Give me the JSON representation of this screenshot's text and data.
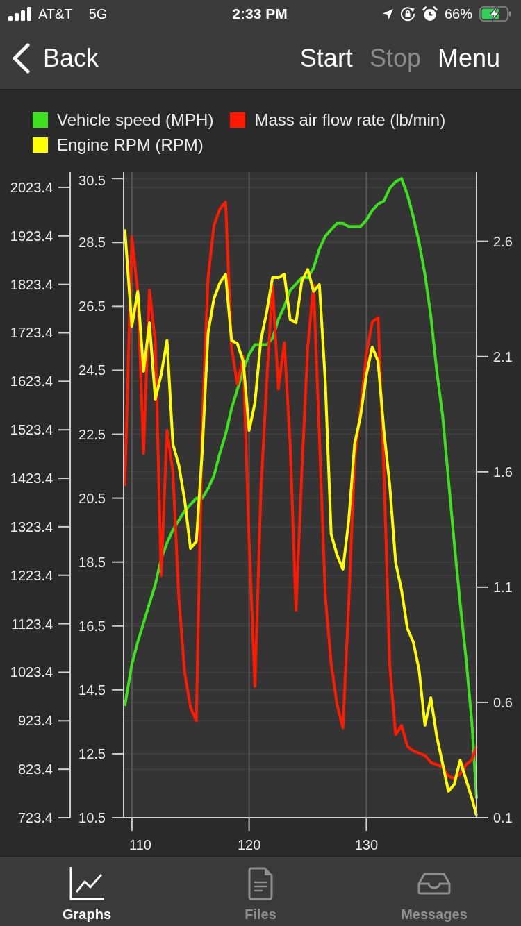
{
  "status_bar": {
    "carrier": "AT&T",
    "network": "5G",
    "time": "2:33 PM",
    "battery": "66%"
  },
  "nav_bar": {
    "back": "Back",
    "actions": [
      {
        "label": "Start",
        "disabled": false
      },
      {
        "label": "Stop",
        "disabled": true
      },
      {
        "label": "Menu",
        "disabled": false
      }
    ]
  },
  "graph": {
    "chart_data": {
      "type": "line",
      "legend": "top",
      "grid": true,
      "x": [
        109.4,
        110,
        110.5,
        111,
        111.5,
        112,
        112.5,
        113,
        113.5,
        114,
        114.5,
        115,
        115.5,
        116,
        116.5,
        117,
        117.5,
        118,
        118.5,
        119,
        119.5,
        120,
        120.5,
        121,
        121.5,
        122,
        122.5,
        123,
        123.5,
        124,
        124.5,
        125,
        125.5,
        126,
        126.5,
        127,
        127.5,
        128,
        128.5,
        129,
        129.5,
        130,
        130.5,
        131,
        131.5,
        132,
        132.5,
        133,
        133.5,
        134,
        134.5,
        135,
        135.5,
        136,
        136.5,
        137,
        137.5,
        138,
        138.5,
        139,
        139.4
      ],
      "xlim": [
        109.3,
        139.4
      ],
      "xticks": [
        110,
        120,
        130
      ],
      "ylim": [
        10.5,
        30.7
      ],
      "yticks": [
        10.5,
        12.5,
        14.5,
        16.5,
        18.5,
        20.5,
        22.5,
        24.5,
        26.5,
        28.5,
        30.5
      ],
      "y2lim": [
        0.1,
        2.9
      ],
      "y2ticks": [
        0.1,
        0.6,
        1.1,
        1.6,
        2.1,
        2.6
      ],
      "y3lim": [
        723.4,
        2054.8
      ],
      "y3ticks": [
        723.4,
        823.4,
        923.4,
        1023.4,
        1123.4,
        1223.4,
        1323.4,
        1423.4,
        1523.4,
        1623.4,
        1723.4,
        1823.4,
        1923.4,
        2023.4
      ],
      "series": [
        {
          "name": "Vehicle speed (MPH)",
          "color": "#3de11e",
          "values": [
            14.0,
            15.3,
            16.0,
            16.6,
            17.2,
            17.8,
            18.6,
            19.1,
            19.5,
            19.8,
            20.1,
            20.3,
            20.5,
            20.5,
            20.8,
            21.2,
            21.9,
            22.5,
            23.3,
            23.9,
            24.5,
            25.0,
            25.3,
            25.3,
            25.3,
            25.5,
            26.1,
            26.5,
            27.0,
            27.2,
            27.4,
            27.4,
            27.7,
            28.3,
            28.7,
            28.9,
            29.1,
            29.1,
            29.0,
            29.0,
            29.0,
            29.2,
            29.5,
            29.7,
            29.8,
            30.2,
            30.4,
            30.5,
            30.0,
            29.3,
            28.5,
            27.5,
            26.2,
            24.5,
            23.1,
            21.1,
            19.1,
            17.2,
            15.5,
            13.5,
            11.1
          ]
        },
        {
          "name": "Mass air flow rate (lb/min)",
          "color": "#ff1a00",
          "axis": "y2",
          "values": [
            1.54,
            2.62,
            2.38,
            1.68,
            2.39,
            2.16,
            1.15,
            1.78,
            1.6,
            1.06,
            0.73,
            0.58,
            0.52,
            1.81,
            2.44,
            2.67,
            2.74,
            2.77,
            2.14,
            1.98,
            2.1,
            1.3,
            0.67,
            1.51,
            1.99,
            2.41,
            1.96,
            2.16,
            1.72,
            1.0,
            1.6,
            2.14,
            2.41,
            1.75,
            1.06,
            0.77,
            0.59,
            0.49,
            1.03,
            1.66,
            1.87,
            2.11,
            2.25,
            2.27,
            1.6,
            0.76,
            0.46,
            0.5,
            0.41,
            0.39,
            0.38,
            0.37,
            0.34,
            0.33,
            0.32,
            0.28,
            0.27,
            0.29,
            0.33,
            0.35,
            0.41
          ]
        },
        {
          "name": "Engine RPM (RPM)",
          "color": "#ffff00",
          "axis": "y3",
          "values": [
            1937,
            1737,
            1809,
            1644,
            1744,
            1587,
            1637,
            1708,
            1494,
            1451,
            1379,
            1279,
            1293,
            1479,
            1723,
            1794,
            1826,
            1844,
            1708,
            1701,
            1665,
            1522,
            1579,
            1708,
            1766,
            1837,
            1837,
            1844,
            1751,
            1744,
            1830,
            1854,
            1809,
            1823,
            1622,
            1308,
            1265,
            1236,
            1336,
            1494,
            1551,
            1637,
            1694,
            1665,
            1520,
            1408,
            1250,
            1193,
            1114,
            1086,
            1028,
            914,
            971,
            892,
            835,
            778,
            792,
            842,
            802,
            764,
            728
          ]
        }
      ]
    }
  },
  "tab_bar": {
    "tabs": [
      {
        "label": "Graphs",
        "selected": true
      },
      {
        "label": "Files",
        "selected": false
      },
      {
        "label": "Messages",
        "selected": false
      }
    ]
  }
}
